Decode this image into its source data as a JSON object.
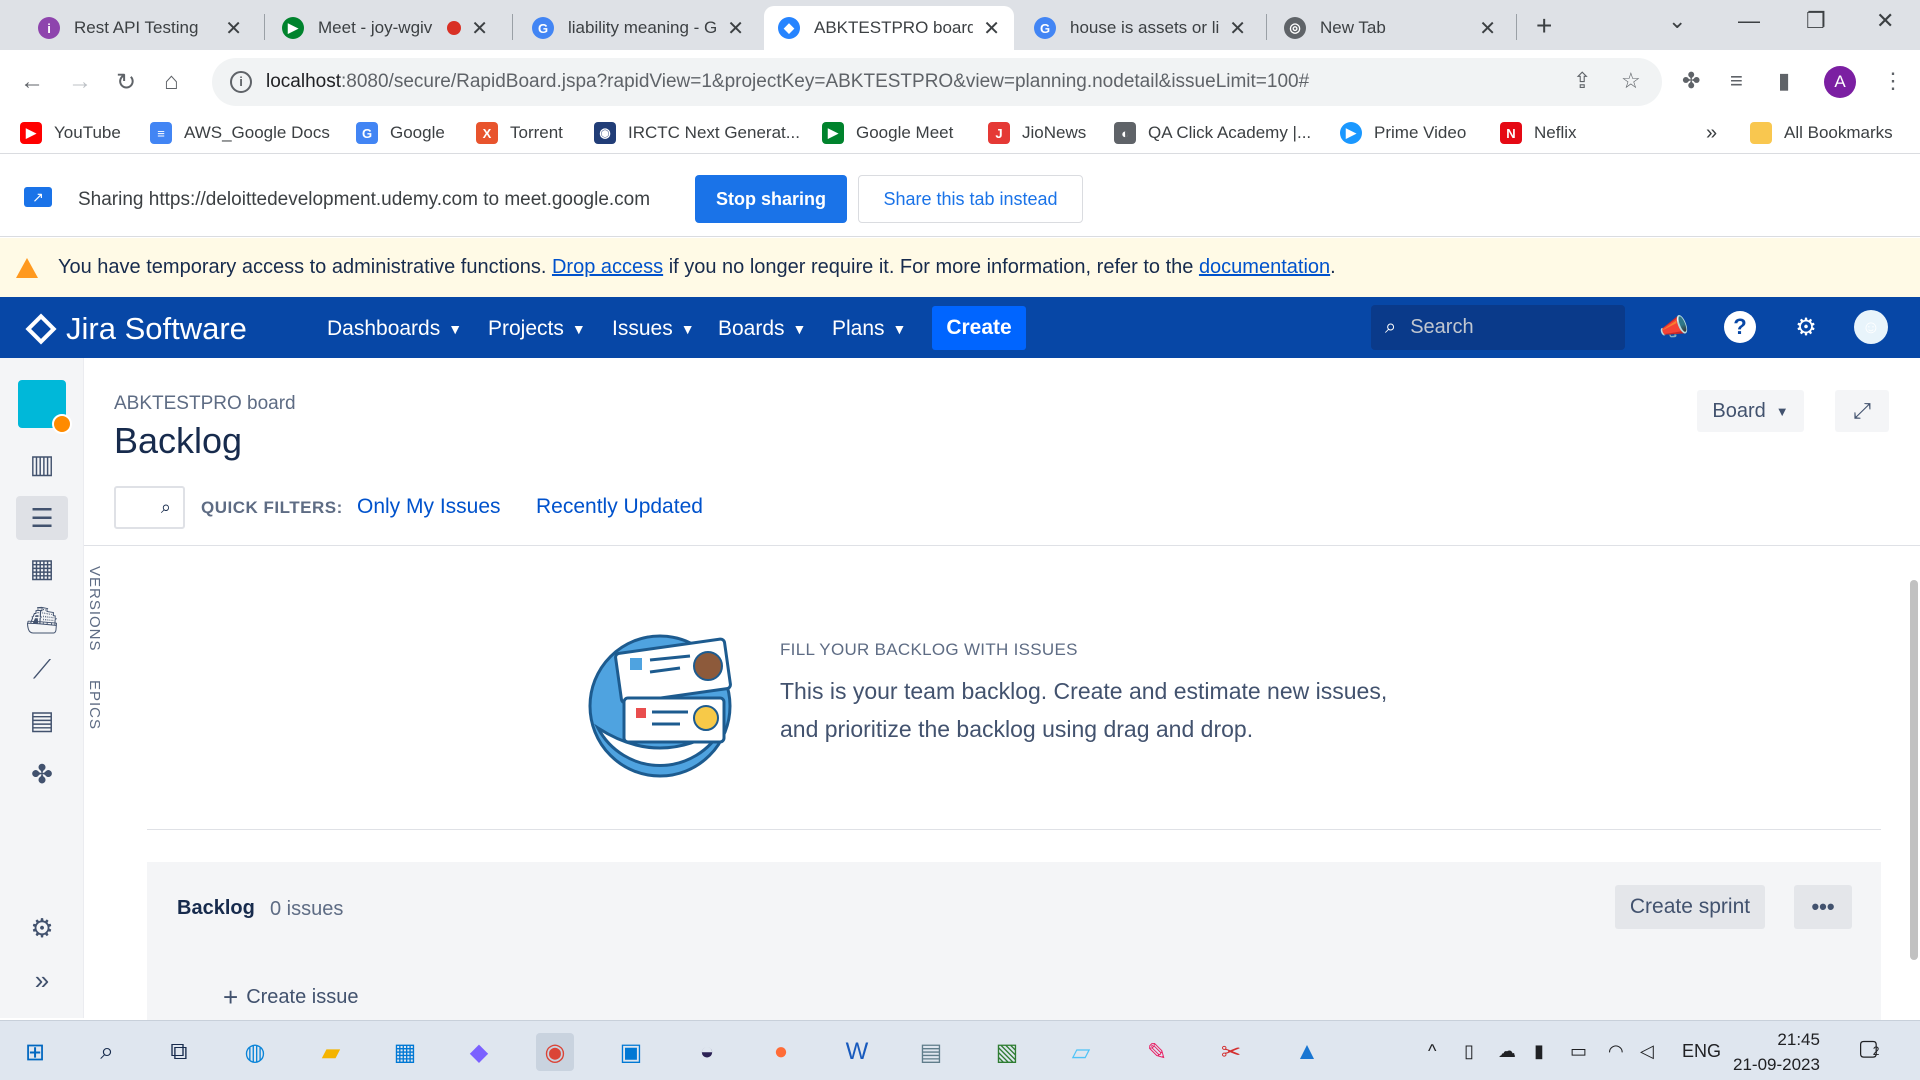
{
  "browser": {
    "tabs": [
      {
        "title": "Rest API Testing",
        "icon_color": "#8e44ad",
        "icon_glyph": "i"
      },
      {
        "title": "Meet - joy-wgiv",
        "icon_color": "#00832d",
        "icon_glyph": "▶"
      },
      {
        "title": "liability meaning - G",
        "icon_color": "#4285f4",
        "icon_glyph": "G"
      },
      {
        "title": "ABKTESTPRO board",
        "icon_color": "#2684ff",
        "icon_glyph": "◆"
      },
      {
        "title": "house is assets or li",
        "icon_color": "#4285f4",
        "icon_glyph": "G"
      },
      {
        "title": "New Tab",
        "icon_color": "#5f6368",
        "icon_glyph": "◎"
      }
    ],
    "url_host": "localhost",
    "url_rest": ":8080/secure/RapidBoard.jspa?rapidView=1&projectKey=ABKTESTPRO&view=planning.nodetail&issueLimit=100#",
    "profile_initial": "A",
    "bookmarks": [
      {
        "label": "YouTube",
        "color": "#ff0000",
        "glyph": "▶"
      },
      {
        "label": "AWS_Google Docs",
        "color": "#4285f4",
        "glyph": "≡"
      },
      {
        "label": "Google",
        "color": "#4285f4",
        "glyph": "G"
      },
      {
        "label": "Torrent",
        "color": "#e8542d",
        "glyph": "X"
      },
      {
        "label": "IRCTC Next Generat...",
        "color": "#213d77",
        "glyph": "◉"
      },
      {
        "label": "Google Meet",
        "color": "#00832d",
        "glyph": "▶"
      },
      {
        "label": "JioNews",
        "color": "#e53935",
        "glyph": "J"
      },
      {
        "label": "QA Click Academy |...",
        "color": "#5f6368",
        "glyph": "◐"
      },
      {
        "label": "Prime Video",
        "color": "#1a98ff",
        "glyph": "▶"
      },
      {
        "label": "Neflix",
        "color": "#e50914",
        "glyph": "N"
      }
    ],
    "bookmarks_overflow": "»",
    "all_bookmarks": "All Bookmarks"
  },
  "sharing": {
    "message": "Sharing https://deloittedevelopment.udemy.com to meet.google.com",
    "stop_label": "Stop sharing",
    "share_tab_label": "Share this tab instead"
  },
  "warning": {
    "before": "You have temporary access to administrative functions.",
    "link1": "Drop access",
    "middle": "if you no longer require it. For more information, refer to the",
    "link2": "documentation",
    "after": "."
  },
  "jira": {
    "logo": "Jira Software",
    "menus": [
      "Dashboards",
      "Projects",
      "Issues",
      "Boards",
      "Plans"
    ],
    "create_label": "Create",
    "search_placeholder": "Search"
  },
  "sidebar_tabs": {
    "versions": "VERSIONS",
    "epics": "EPICS"
  },
  "main": {
    "breadcrumb": "ABKTESTPRO board",
    "title": "Backlog",
    "board_button": "Board",
    "quick_filters_label": "QUICK FILTERS:",
    "quick_filters": [
      "Only My Issues",
      "Recently Updated"
    ],
    "empty_heading": "FILL YOUR BACKLOG WITH ISSUES",
    "empty_body": "This is your team backlog. Create and estimate new issues, and prioritize the backlog using drag and drop.",
    "backlog_title": "Backlog",
    "backlog_count": "0 issues",
    "create_sprint": "Create sprint",
    "create_issue": "Create issue"
  },
  "taskbar": {
    "language": "ENG",
    "time": "21:45",
    "date": "21-09-2023",
    "notifications": "2"
  }
}
